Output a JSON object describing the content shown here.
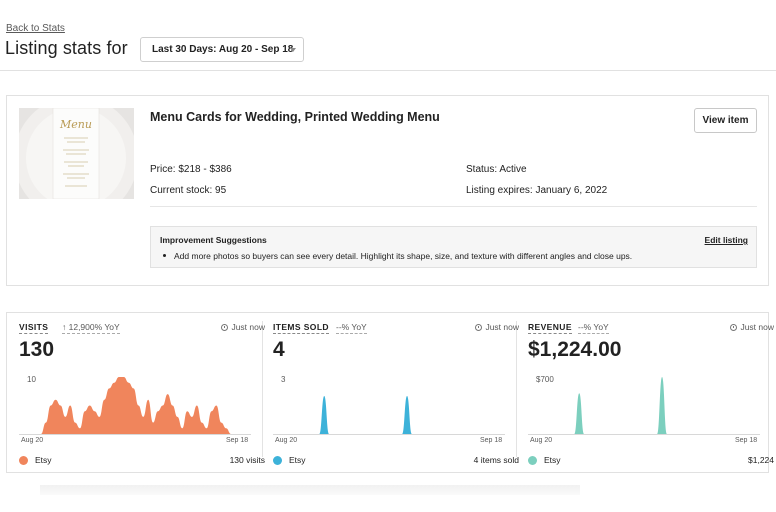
{
  "header": {
    "back_link": "Back to Stats",
    "title": "Listing stats for",
    "date_range": "Last 30 Days: Aug 20 - Sep 18"
  },
  "listing": {
    "title": "Menu Cards for Wedding, Printed Wedding Menu",
    "view_button": "View item",
    "price": "Price: $218 - $386",
    "stock": "Current stock: 95",
    "status": "Status: Active",
    "expires": "Listing expires: January 6, 2022",
    "thumbnail_caption": "Menu"
  },
  "suggestions": {
    "title": "Improvement Suggestions",
    "edit_link": "Edit listing",
    "items": [
      "Add more photos so buyers can see every detail. Highlight its shape, size, and texture with different angles and close ups."
    ]
  },
  "stats": [
    {
      "label": "VISITS",
      "yoy": "↑ 12,900% YoY",
      "updated": "Just now",
      "value": "130",
      "legend": "Etsy",
      "total": "130 visits",
      "color": "#f0855c"
    },
    {
      "label": "ITEMS SOLD",
      "yoy": "--% YoY",
      "updated": "Just now",
      "value": "4",
      "legend": "Etsy",
      "total": "4 items sold",
      "color": "#3db2d9"
    },
    {
      "label": "REVENUE",
      "yoy": "--% YoY",
      "updated": "Just now",
      "value": "$1,224.00",
      "legend": "Etsy",
      "total": "$1,224",
      "color": "#7ccfbe"
    }
  ],
  "chart_data": [
    {
      "type": "area",
      "series": [
        {
          "name": "Etsy",
          "values": [
            0,
            2,
            5,
            6,
            5,
            3,
            5,
            2,
            1,
            4,
            5,
            4,
            3,
            6,
            8,
            9,
            10,
            10,
            9,
            8,
            5,
            3,
            6,
            2,
            4,
            5,
            7,
            5,
            3,
            1,
            4,
            3,
            5,
            2,
            1,
            4,
            5,
            2,
            1,
            0
          ]
        }
      ],
      "ylim": [
        0,
        10
      ],
      "yticks": [
        "10"
      ],
      "x_start": "Aug 20",
      "x_end": "Sep 18"
    },
    {
      "type": "area",
      "series": [
        {
          "name": "Etsy",
          "values": [
            0,
            0,
            0,
            0,
            0,
            0,
            2,
            0,
            0,
            0,
            0,
            0,
            0,
            0,
            0,
            0,
            0,
            0,
            0,
            0,
            0,
            0,
            0,
            2,
            0,
            0,
            0,
            0,
            0,
            0,
            0,
            0,
            0,
            0,
            0,
            0,
            0,
            0,
            0,
            0
          ]
        }
      ],
      "ylim": [
        0,
        3
      ],
      "yticks": [
        "3"
      ],
      "x_start": "Aug 20",
      "x_end": "Sep 18"
    },
    {
      "type": "area",
      "series": [
        {
          "name": "Etsy",
          "values": [
            0,
            0,
            0,
            0,
            0,
            0,
            500,
            0,
            0,
            0,
            0,
            0,
            0,
            0,
            0,
            0,
            0,
            0,
            0,
            0,
            0,
            0,
            0,
            700,
            0,
            0,
            0,
            0,
            0,
            0,
            0,
            0,
            0,
            0,
            0,
            0,
            0,
            0,
            0,
            0
          ]
        }
      ],
      "ylim": [
        0,
        700
      ],
      "yticks": [
        "$700"
      ],
      "x_start": "Aug 20",
      "x_end": "Sep 18"
    }
  ]
}
